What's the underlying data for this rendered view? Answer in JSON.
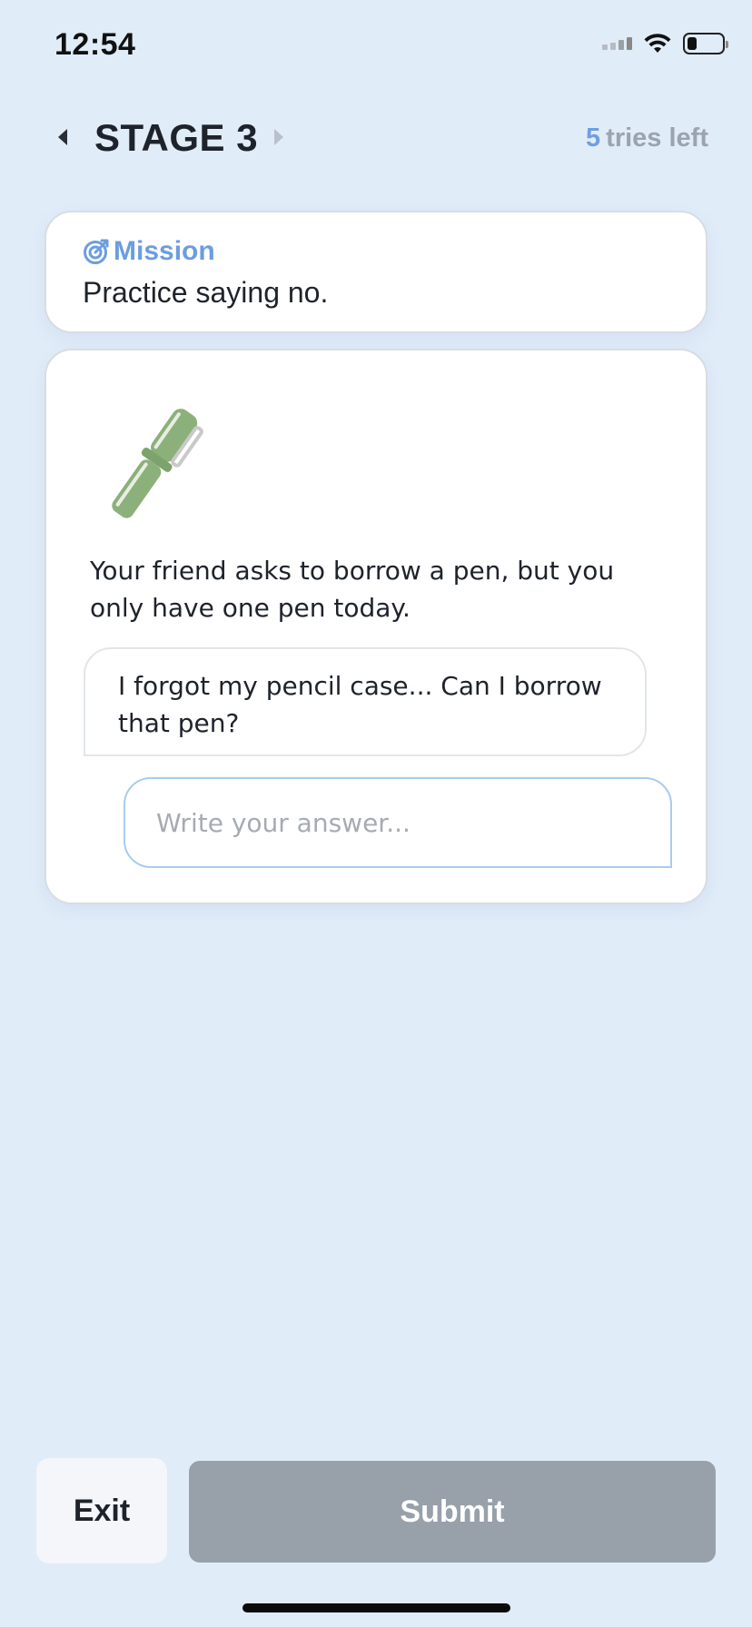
{
  "status_bar": {
    "time": "12:54"
  },
  "header": {
    "stage_title": "STAGE 3",
    "tries_count": "5",
    "tries_label": "tries left"
  },
  "mission": {
    "label": "Mission",
    "text": "Practice saying no."
  },
  "scenario": {
    "illustration": "pen-icon",
    "description": "Your friend asks to borrow a pen, but you only have one pen today.",
    "friend_message": "I forgot my pencil case... Can I borrow that pen?",
    "answer_value": "",
    "answer_placeholder": "Write your answer..."
  },
  "actions": {
    "exit_label": "Exit",
    "submit_label": "Submit"
  },
  "colors": {
    "background": "#e1ecf9",
    "accent": "#6b9de0",
    "submit_disabled": "#98a0aa"
  }
}
